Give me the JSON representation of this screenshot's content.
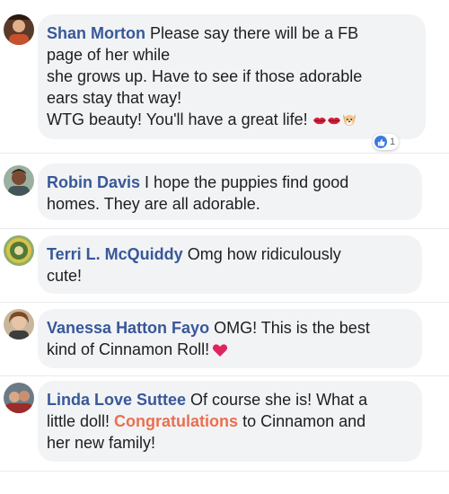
{
  "comments": [
    {
      "author": "Shan Morton",
      "text_lines": [
        "Please say there will be a FB",
        "page of her while",
        "she grows up. Have to see if those adorable",
        "ears stay that way!",
        "WTG beauty! You'll have a great life!"
      ],
      "emojis": [
        "lips-emoji",
        "lips-emoji",
        "dog-face-emoji"
      ],
      "reaction": {
        "icon": "like-icon",
        "count": "1"
      }
    },
    {
      "author": "Robin Davis",
      "text_first": "I hope the puppies find good",
      "text_second": "homes. They are all adorable."
    },
    {
      "author": "Terri L. McQuiddy",
      "text_first": "Omg how ridiculously",
      "text_second": "cute!"
    },
    {
      "author": "Vanessa Hatton Fayo",
      "text_first": "OMG! This is the best",
      "text_second": "kind of Cinnamon Roll!",
      "emoji": "red-heart-emoji"
    },
    {
      "author": "Linda Love Suttee",
      "text_first": "Of course she is! What a",
      "text_second_pre": "little doll!",
      "link": "Congratulations",
      "text_second_post": "to Cinnamon and",
      "text_third": "her new family!"
    }
  ],
  "colors": {
    "author": "#385898",
    "link": "#e9704f",
    "bubble": "#f2f3f5",
    "like": "#3b7ae3",
    "heart": "#e0245e"
  }
}
